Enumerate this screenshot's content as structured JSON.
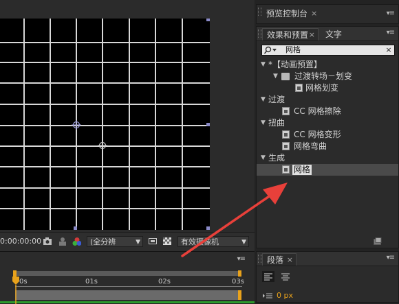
{
  "viewer": {
    "timecode": "0:00:00:00",
    "resolution": "(全分辨",
    "camera": "有效摄像机"
  },
  "preview_panel": {
    "title": "预览控制台",
    "close": "×",
    "menu": "▾≡"
  },
  "effects_panel": {
    "tabs": [
      {
        "label": "效果和预置",
        "close": "×"
      },
      {
        "label": "文字"
      }
    ],
    "menu": "▾≡",
    "search": {
      "value": "网格",
      "clear": "×"
    },
    "tree": [
      {
        "label": "*【动画预置】"
      },
      {
        "label": "过渡转场－划变"
      },
      {
        "label": "网格划变"
      },
      {
        "label": "过渡"
      },
      {
        "label": "CC 网格擦除"
      },
      {
        "label": "扭曲"
      },
      {
        "label": "CC 网格变形"
      },
      {
        "label": "网格弯曲"
      },
      {
        "label": "生成"
      },
      {
        "label": "网格"
      }
    ]
  },
  "paragraph_panel": {
    "title": "段落",
    "close": "×",
    "menu": "▾≡",
    "indent_value": "0 px"
  },
  "timeline": {
    "menu": "▾≡",
    "ticks": [
      "0s",
      "01s",
      "02s",
      "03s"
    ]
  },
  "colors": {
    "annotation_arrow": "#e8403a",
    "timeline_green": "#2c9a2c",
    "playhead": "#e8a21c"
  }
}
